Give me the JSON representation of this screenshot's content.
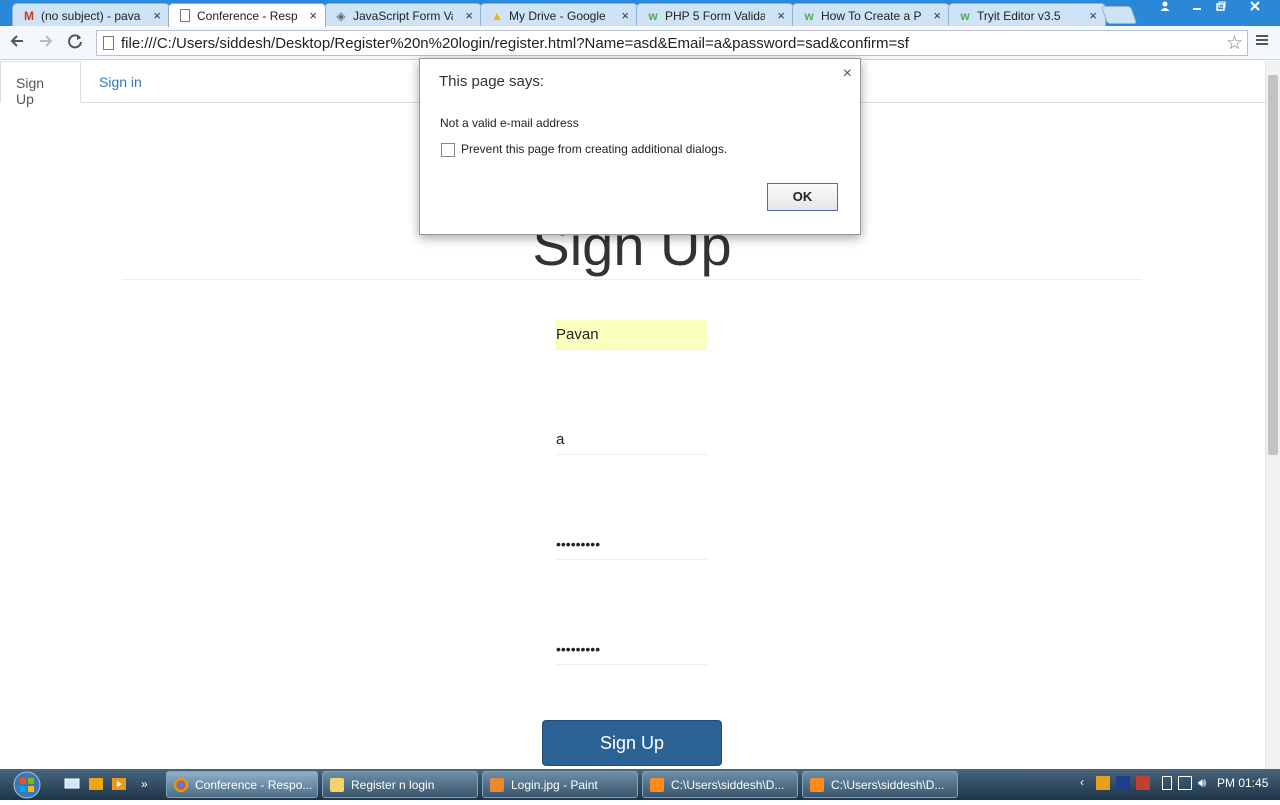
{
  "browser": {
    "tabs": [
      {
        "label": "(no subject) - pava",
        "icon": "gmail-icon",
        "active": false
      },
      {
        "label": "Conference - Respo",
        "icon": "page-icon",
        "active": true
      },
      {
        "label": "JavaScript Form Va",
        "icon": "w3-icon",
        "active": false
      },
      {
        "label": "My Drive - Google",
        "icon": "drive-icon",
        "active": false
      },
      {
        "label": "PHP 5 Form Valida",
        "icon": "w3schools-icon",
        "active": false
      },
      {
        "label": "How To Create a P",
        "icon": "w3schools-icon",
        "active": false
      },
      {
        "label": "Tryit Editor v3.5",
        "icon": "w3schools-icon",
        "active": false
      }
    ],
    "close_glyph": "×",
    "url": "file:///C:/Users/siddesh/Desktop/Register%20n%20login/register.html?Name=asd&Email=a&password=sad&confirm=sf"
  },
  "page": {
    "nav_tabs": [
      {
        "label": "Sign Up",
        "active": true
      },
      {
        "label": "Sign in",
        "active": false
      }
    ],
    "heading": "Sign Up",
    "fields": {
      "name": "Pavan",
      "email": "a",
      "password": "•••••••••",
      "confirm": "•••••••••"
    },
    "submit_label": "Sign Up"
  },
  "dialog": {
    "title": "This page says:",
    "message": "Not a valid e-mail address",
    "checkbox_label": "Prevent this page from creating additional dialogs.",
    "ok_label": "OK",
    "close_glyph": "×"
  },
  "taskbar": {
    "items": [
      {
        "label": "Conference - Respo...",
        "active": true
      },
      {
        "label": "Register n login",
        "active": false
      },
      {
        "label": "Login.jpg - Paint",
        "active": false
      },
      {
        "label": "C:\\Users\\siddesh\\D...",
        "active": false
      },
      {
        "label": "C:\\Users\\siddesh\\D...",
        "active": false
      }
    ],
    "clock": "PM 01:45"
  }
}
